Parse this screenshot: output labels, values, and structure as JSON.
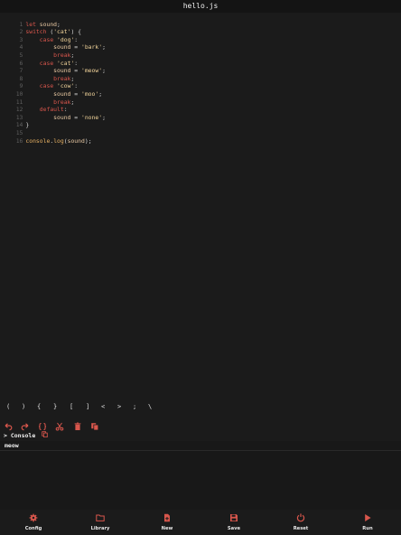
{
  "window": {
    "title": "hello.js"
  },
  "editor": {
    "lines": [
      {
        "n": "1"
      },
      {
        "n": "2"
      },
      {
        "n": "3"
      },
      {
        "n": "4"
      },
      {
        "n": "5"
      },
      {
        "n": "6"
      },
      {
        "n": "7"
      },
      {
        "n": "8"
      },
      {
        "n": "9"
      },
      {
        "n": "10"
      },
      {
        "n": "11"
      },
      {
        "n": "12"
      },
      {
        "n": "13"
      },
      {
        "n": "14"
      },
      {
        "n": "15"
      },
      {
        "n": "16"
      }
    ],
    "code": {
      "l1_kw": "let",
      "l1_var": "sound",
      "l1_end": ";",
      "l2_kw": "switch",
      "l2_open": " (",
      "l2_str": "'cat'",
      "l2_close": ") {",
      "l3_kw": "case",
      "l3_str": "'dog'",
      "l3_colon": ":",
      "l4_var": "sound",
      "l4_eq": " = ",
      "l4_str": "'bark'",
      "l4_end": ";",
      "l5_kw": "break",
      "l5_end": ";",
      "l6_kw": "case",
      "l6_str": "'cat'",
      "l6_colon": ":",
      "l7_var": "sound",
      "l7_eq": " = ",
      "l7_str": "'meow'",
      "l7_end": ";",
      "l8_kw": "break",
      "l8_end": ";",
      "l9_kw": "case",
      "l9_str": "'cow'",
      "l9_colon": ":",
      "l10_var": "sound",
      "l10_eq": " = ",
      "l10_str": "'moo'",
      "l10_end": ";",
      "l11_kw": "break",
      "l11_end": ";",
      "l12_kw": "default",
      "l12_colon": ":",
      "l13_var": "sound",
      "l13_eq": " = ",
      "l13_str": "'none'",
      "l13_end": ";",
      "l14_close": "}",
      "l16_obj": "console",
      "l16_dot": ".",
      "l16_fn": "log",
      "l16_open": "(",
      "l16_var": "sound",
      "l16_close": ");"
    }
  },
  "symbols": [
    "(",
    ")",
    "{",
    "}",
    "[",
    "]",
    "<",
    ">",
    ";",
    "\\"
  ],
  "tools": [
    {
      "icon": "undo-icon"
    },
    {
      "icon": "redo-icon"
    },
    {
      "icon": "braces-icon"
    },
    {
      "icon": "cut-icon"
    },
    {
      "icon": "delete-icon"
    },
    {
      "icon": "copy-icon"
    }
  ],
  "console": {
    "prompt": ">",
    "title": "Console",
    "output": "meow"
  },
  "nav": [
    {
      "label": "Config",
      "icon": "gear-icon"
    },
    {
      "label": "Library",
      "icon": "folder-icon"
    },
    {
      "label": "New",
      "icon": "new-file-icon"
    },
    {
      "label": "Save",
      "icon": "save-icon"
    },
    {
      "label": "Reset",
      "icon": "reset-icon"
    },
    {
      "label": "Run",
      "icon": "play-icon"
    }
  ],
  "colors": {
    "accent": "#d8564c",
    "background": "#1b1b1b",
    "keyword": "#d8564c",
    "string": "#f1d39a"
  }
}
